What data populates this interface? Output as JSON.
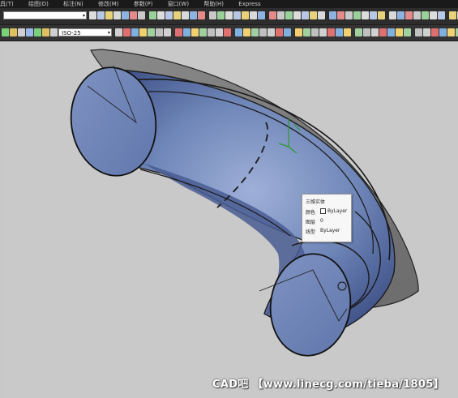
{
  "menubar": {
    "items": [
      "具(T)",
      "绘图(D)",
      "标注(N)",
      "修改(M)",
      "参数(P)",
      "窗口(W)",
      "帮助(H)",
      "Express"
    ]
  },
  "toolbar2": {
    "dimstyle_value": "ISO-25"
  },
  "tooltip": {
    "title": "三维实体",
    "rows": [
      {
        "key": "颜色",
        "value": "ByLayer",
        "swatch": true
      },
      {
        "key": "图层",
        "value": "0",
        "swatch": false
      },
      {
        "key": "线型",
        "value": "ByLayer",
        "swatch": false
      }
    ]
  },
  "watermark": "CAD吧 【www.linecg.com/tieba/1805】",
  "colors": {
    "solid": "#6f86b8",
    "solid_dark": "#3e5188",
    "surface": "#7e7e7e",
    "viewport": "#c9c9c9",
    "cursor": "#2e9a2e"
  }
}
